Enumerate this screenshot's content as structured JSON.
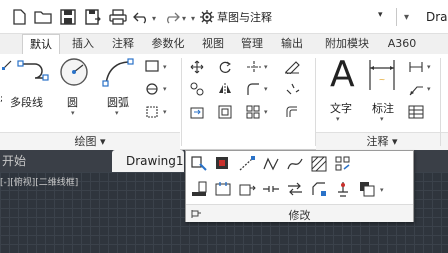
{
  "workspace": {
    "label": "草图与注释"
  },
  "app_title": "Draw",
  "ribbon_tabs": [
    "默认",
    "插入",
    "注释",
    "参数化",
    "视图",
    "管理",
    "输出",
    "附加模块",
    "A360"
  ],
  "draw_panel": {
    "polyline_label": "多段线",
    "circle_label": "圆",
    "arc_label": "圆弧",
    "footer_label": "绘图 ▾"
  },
  "annotation_panel": {
    "text_label": "文字",
    "dimension_label": "标注",
    "footer_label": "注释 ▾"
  },
  "doc_tabs": {
    "start": "开始",
    "drawing": "Drawing1"
  },
  "viewport_label": "[-][俯视][二维线框]",
  "modify_flyout": {
    "title": "修改"
  },
  "colors": {
    "canvas": "#2f353d",
    "accent": "#c9302c",
    "tab_bar": "#3a3f47"
  }
}
